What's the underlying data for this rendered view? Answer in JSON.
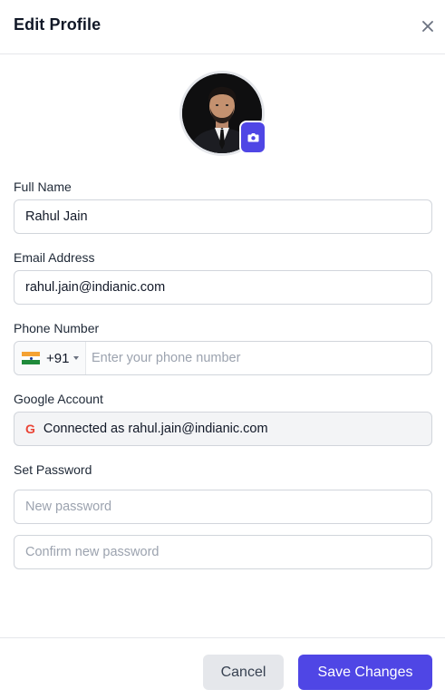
{
  "modal": {
    "title": "Edit Profile",
    "close_icon": "close-icon"
  },
  "avatar": {
    "alt": "Profile photo",
    "camera_icon": "camera-icon"
  },
  "full_name": {
    "label": "Full Name",
    "value": "Rahul Jain"
  },
  "email": {
    "label": "Email Address",
    "value": "rahul.jain@indianic.com"
  },
  "phone": {
    "label": "Phone Number",
    "country_flag": "india-flag-icon",
    "dial_code": "+91",
    "placeholder": "Enter your phone number",
    "value": ""
  },
  "google": {
    "label": "Google Account",
    "icon": "google-icon",
    "icon_glyph": "G",
    "status": "Connected as rahul.jain@indianic.com"
  },
  "password": {
    "label": "Set Password",
    "new_placeholder": "New password",
    "confirm_placeholder": "Confirm new password"
  },
  "footer": {
    "cancel_label": "Cancel",
    "save_label": "Save Changes"
  },
  "colors": {
    "accent": "#4f46e5",
    "google_red": "#ea4335",
    "border": "#d1d5db",
    "disabled_bg": "#f3f4f6"
  }
}
